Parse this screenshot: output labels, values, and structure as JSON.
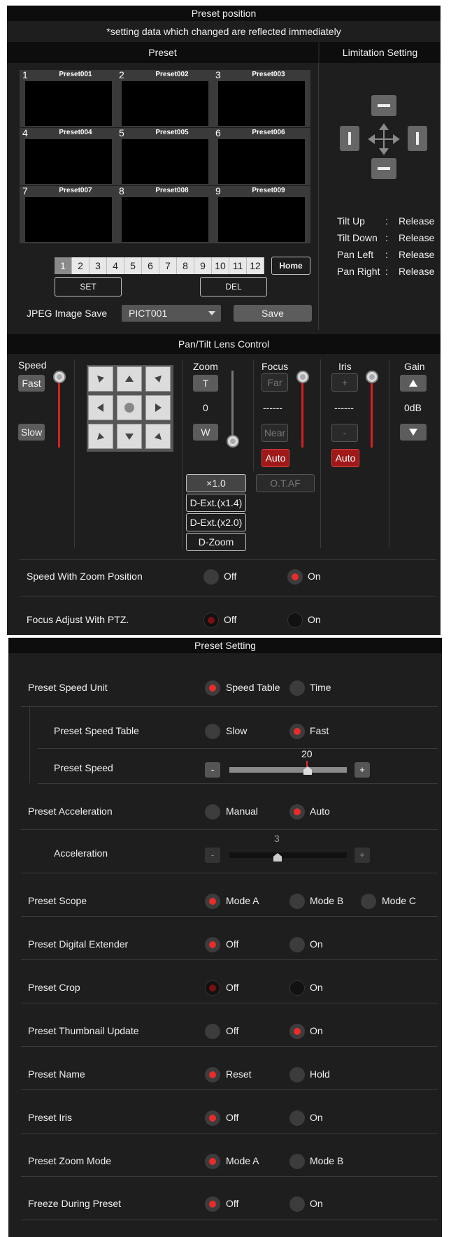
{
  "header": {
    "title": "Preset position",
    "note": "*setting data which changed are reflected immediately"
  },
  "preset_section": {
    "title": "Preset",
    "presets": [
      {
        "num": "1",
        "name": "Preset001"
      },
      {
        "num": "2",
        "name": "Preset002"
      },
      {
        "num": "3",
        "name": "Preset003"
      },
      {
        "num": "4",
        "name": "Preset004"
      },
      {
        "num": "5",
        "name": "Preset005"
      },
      {
        "num": "6",
        "name": "Preset006"
      },
      {
        "num": "7",
        "name": "Preset007"
      },
      {
        "num": "8",
        "name": "Preset008"
      },
      {
        "num": "9",
        "name": "Preset009"
      }
    ],
    "pages": [
      "1",
      "2",
      "3",
      "4",
      "5",
      "6",
      "7",
      "8",
      "9",
      "10",
      "11",
      "12"
    ],
    "active_page": "1",
    "home_label": "Home",
    "set_label": "SET",
    "del_label": "DEL",
    "jpeg_label": "JPEG Image Save",
    "jpeg_value": "PICT001",
    "save_label": "Save"
  },
  "limitation": {
    "title": "Limitation Setting",
    "items": [
      {
        "label": "Tilt Up",
        "sep": ":",
        "value": "Release"
      },
      {
        "label": "Tilt Down",
        "sep": ":",
        "value": "Release"
      },
      {
        "label": "Pan Left",
        "sep": ":",
        "value": "Release"
      },
      {
        "label": "Pan Right",
        "sep": ":",
        "value": "Release"
      }
    ]
  },
  "pantilt": {
    "title": "Pan/Tilt Lens Control",
    "speed_label": "Speed",
    "fast_label": "Fast",
    "slow_label": "Slow",
    "dpad_center": "●",
    "zoom_label": "Zoom",
    "zoom_t": "T",
    "zoom_value": "0",
    "zoom_w": "W",
    "zoom_x1": "×1.0",
    "dext14": "D-Ext.(x1.4)",
    "dext20": "D-Ext.(x2.0)",
    "dzoom": "D-Zoom",
    "focus_label": "Focus",
    "focus_far": "Far",
    "focus_value": "------",
    "focus_near": "Near",
    "focus_auto": "Auto",
    "otaf": "O.T.AF",
    "iris_label": "Iris",
    "iris_plus": "+",
    "iris_value": "------",
    "iris_minus": "-",
    "iris_auto": "Auto",
    "gain_label": "Gain",
    "gain_value": "0dB"
  },
  "pantilt_rows": [
    {
      "label": "Speed With Zoom Position",
      "opt1": "Off",
      "opt2": "On",
      "selected": 2
    },
    {
      "label": "Focus Adjust With PTZ.",
      "opt1": "Off",
      "opt2": "On",
      "selected": 1
    }
  ],
  "preset_setting": {
    "title": "Preset Setting",
    "speed_unit": {
      "label": "Preset Speed Unit",
      "opt1": "Speed Table",
      "opt2": "Time"
    },
    "speed_table": {
      "label": "Preset Speed Table",
      "opt1": "Slow",
      "opt2": "Fast"
    },
    "speed": {
      "label": "Preset Speed",
      "value": "20",
      "minus": "-",
      "plus": "+"
    },
    "acceleration_mode": {
      "label": "Preset Acceleration",
      "opt1": "Manual",
      "opt2": "Auto"
    },
    "acceleration": {
      "label": "Acceleration",
      "value": "3",
      "minus": "-",
      "plus": "+"
    },
    "scope": {
      "label": "Preset Scope",
      "opt1": "Mode A",
      "opt2": "Mode B",
      "opt3": "Mode C"
    },
    "digital_ext": {
      "label": "Preset Digital Extender",
      "opt1": "Off",
      "opt2": "On"
    },
    "crop": {
      "label": "Preset Crop",
      "opt1": "Off",
      "opt2": "On"
    },
    "thumb": {
      "label": "Preset Thumbnail Update",
      "opt1": "Off",
      "opt2": "On"
    },
    "name": {
      "label": "Preset Name",
      "opt1": "Reset",
      "opt2": "Hold"
    },
    "iris": {
      "label": "Preset Iris",
      "opt1": "Off",
      "opt2": "On"
    },
    "zoom_mode": {
      "label": "Preset Zoom Mode",
      "opt1": "Mode A",
      "opt2": "Mode B"
    },
    "freeze": {
      "label": "Freeze During Preset",
      "opt1": "Off",
      "opt2": "On"
    }
  },
  "colors": {
    "accent": "#e82c2c",
    "panel": "#1e1e1e",
    "header": "#0d0d0d"
  }
}
